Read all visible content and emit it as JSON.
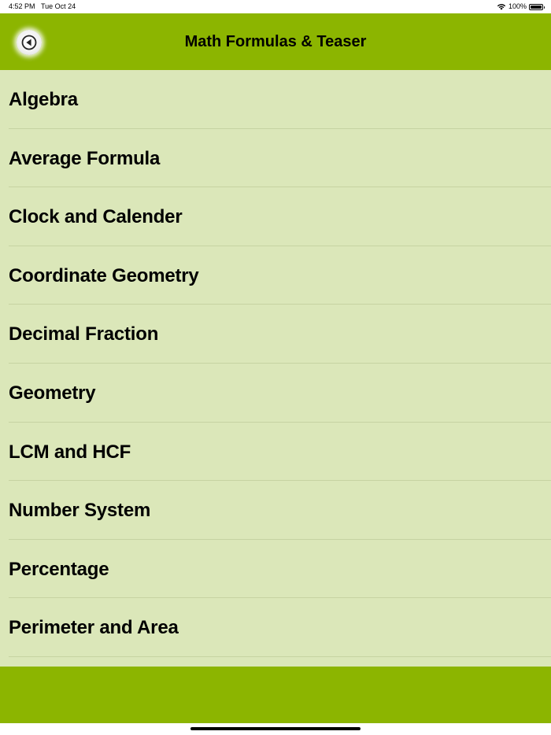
{
  "status_bar": {
    "time": "4:52 PM",
    "date": "Tue Oct 24",
    "battery": "100%"
  },
  "nav": {
    "title": "Math Formulas & Teaser",
    "back_icon": "back-arrow-circle-icon",
    "background_color": "#8cb500"
  },
  "list": {
    "background_color": "#dbe7b9",
    "items": [
      {
        "label": "Algebra"
      },
      {
        "label": "Average Formula"
      },
      {
        "label": "Clock and Calender"
      },
      {
        "label": "Coordinate Geometry"
      },
      {
        "label": "Decimal Fraction"
      },
      {
        "label": "Geometry"
      },
      {
        "label": "LCM and HCF"
      },
      {
        "label": "Number System"
      },
      {
        "label": "Percentage"
      },
      {
        "label": "Perimeter and Area"
      }
    ]
  }
}
